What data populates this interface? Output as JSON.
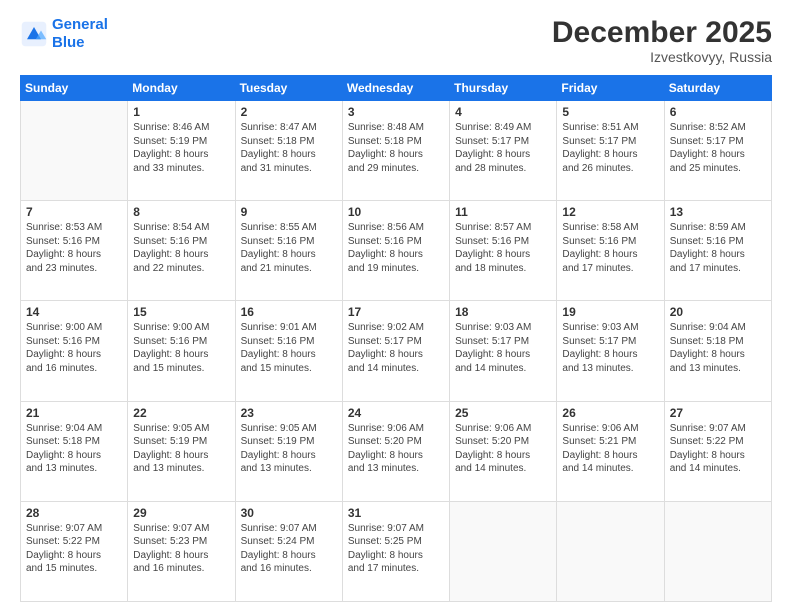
{
  "header": {
    "logo_line1": "General",
    "logo_line2": "Blue",
    "title": "December 2025",
    "subtitle": "Izvestkovyy, Russia"
  },
  "days_of_week": [
    "Sunday",
    "Monday",
    "Tuesday",
    "Wednesday",
    "Thursday",
    "Friday",
    "Saturday"
  ],
  "weeks": [
    [
      {
        "num": "",
        "info": ""
      },
      {
        "num": "1",
        "info": "Sunrise: 8:46 AM\nSunset: 5:19 PM\nDaylight: 8 hours\nand 33 minutes."
      },
      {
        "num": "2",
        "info": "Sunrise: 8:47 AM\nSunset: 5:18 PM\nDaylight: 8 hours\nand 31 minutes."
      },
      {
        "num": "3",
        "info": "Sunrise: 8:48 AM\nSunset: 5:18 PM\nDaylight: 8 hours\nand 29 minutes."
      },
      {
        "num": "4",
        "info": "Sunrise: 8:49 AM\nSunset: 5:17 PM\nDaylight: 8 hours\nand 28 minutes."
      },
      {
        "num": "5",
        "info": "Sunrise: 8:51 AM\nSunset: 5:17 PM\nDaylight: 8 hours\nand 26 minutes."
      },
      {
        "num": "6",
        "info": "Sunrise: 8:52 AM\nSunset: 5:17 PM\nDaylight: 8 hours\nand 25 minutes."
      }
    ],
    [
      {
        "num": "7",
        "info": "Sunrise: 8:53 AM\nSunset: 5:16 PM\nDaylight: 8 hours\nand 23 minutes."
      },
      {
        "num": "8",
        "info": "Sunrise: 8:54 AM\nSunset: 5:16 PM\nDaylight: 8 hours\nand 22 minutes."
      },
      {
        "num": "9",
        "info": "Sunrise: 8:55 AM\nSunset: 5:16 PM\nDaylight: 8 hours\nand 21 minutes."
      },
      {
        "num": "10",
        "info": "Sunrise: 8:56 AM\nSunset: 5:16 PM\nDaylight: 8 hours\nand 19 minutes."
      },
      {
        "num": "11",
        "info": "Sunrise: 8:57 AM\nSunset: 5:16 PM\nDaylight: 8 hours\nand 18 minutes."
      },
      {
        "num": "12",
        "info": "Sunrise: 8:58 AM\nSunset: 5:16 PM\nDaylight: 8 hours\nand 17 minutes."
      },
      {
        "num": "13",
        "info": "Sunrise: 8:59 AM\nSunset: 5:16 PM\nDaylight: 8 hours\nand 17 minutes."
      }
    ],
    [
      {
        "num": "14",
        "info": "Sunrise: 9:00 AM\nSunset: 5:16 PM\nDaylight: 8 hours\nand 16 minutes."
      },
      {
        "num": "15",
        "info": "Sunrise: 9:00 AM\nSunset: 5:16 PM\nDaylight: 8 hours\nand 15 minutes."
      },
      {
        "num": "16",
        "info": "Sunrise: 9:01 AM\nSunset: 5:16 PM\nDaylight: 8 hours\nand 15 minutes."
      },
      {
        "num": "17",
        "info": "Sunrise: 9:02 AM\nSunset: 5:17 PM\nDaylight: 8 hours\nand 14 minutes."
      },
      {
        "num": "18",
        "info": "Sunrise: 9:03 AM\nSunset: 5:17 PM\nDaylight: 8 hours\nand 14 minutes."
      },
      {
        "num": "19",
        "info": "Sunrise: 9:03 AM\nSunset: 5:17 PM\nDaylight: 8 hours\nand 13 minutes."
      },
      {
        "num": "20",
        "info": "Sunrise: 9:04 AM\nSunset: 5:18 PM\nDaylight: 8 hours\nand 13 minutes."
      }
    ],
    [
      {
        "num": "21",
        "info": "Sunrise: 9:04 AM\nSunset: 5:18 PM\nDaylight: 8 hours\nand 13 minutes."
      },
      {
        "num": "22",
        "info": "Sunrise: 9:05 AM\nSunset: 5:19 PM\nDaylight: 8 hours\nand 13 minutes."
      },
      {
        "num": "23",
        "info": "Sunrise: 9:05 AM\nSunset: 5:19 PM\nDaylight: 8 hours\nand 13 minutes."
      },
      {
        "num": "24",
        "info": "Sunrise: 9:06 AM\nSunset: 5:20 PM\nDaylight: 8 hours\nand 13 minutes."
      },
      {
        "num": "25",
        "info": "Sunrise: 9:06 AM\nSunset: 5:20 PM\nDaylight: 8 hours\nand 14 minutes."
      },
      {
        "num": "26",
        "info": "Sunrise: 9:06 AM\nSunset: 5:21 PM\nDaylight: 8 hours\nand 14 minutes."
      },
      {
        "num": "27",
        "info": "Sunrise: 9:07 AM\nSunset: 5:22 PM\nDaylight: 8 hours\nand 14 minutes."
      }
    ],
    [
      {
        "num": "28",
        "info": "Sunrise: 9:07 AM\nSunset: 5:22 PM\nDaylight: 8 hours\nand 15 minutes."
      },
      {
        "num": "29",
        "info": "Sunrise: 9:07 AM\nSunset: 5:23 PM\nDaylight: 8 hours\nand 16 minutes."
      },
      {
        "num": "30",
        "info": "Sunrise: 9:07 AM\nSunset: 5:24 PM\nDaylight: 8 hours\nand 16 minutes."
      },
      {
        "num": "31",
        "info": "Sunrise: 9:07 AM\nSunset: 5:25 PM\nDaylight: 8 hours\nand 17 minutes."
      },
      {
        "num": "",
        "info": ""
      },
      {
        "num": "",
        "info": ""
      },
      {
        "num": "",
        "info": ""
      }
    ]
  ]
}
